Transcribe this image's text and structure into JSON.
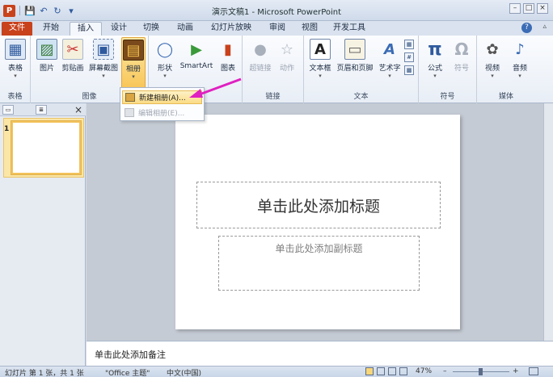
{
  "window": {
    "title": "演示文稿1 - Microsoft PowerPoint"
  },
  "qat": {
    "logo": "P",
    "save": "💾",
    "undo": "↶",
    "redo": "↻",
    "custom": "▾"
  },
  "controls": {
    "minimize": "–",
    "maximize": "□",
    "close": "×",
    "help": "?",
    "min_ribbon": "▵"
  },
  "tabs": [
    {
      "label": "文件"
    },
    {
      "label": "开始"
    },
    {
      "label": "插入"
    },
    {
      "label": "设计"
    },
    {
      "label": "切换"
    },
    {
      "label": "动画"
    },
    {
      "label": "幻灯片放映"
    },
    {
      "label": "审阅"
    },
    {
      "label": "视图"
    },
    {
      "label": "开发工具"
    }
  ],
  "ribbon": {
    "groups": {
      "tables": "表格",
      "images": "图像",
      "links": "链接",
      "text": "文本",
      "symbols": "符号",
      "media": "媒体"
    },
    "buttons": {
      "table": "表格",
      "picture": "图片",
      "clipart": "剪贴画",
      "screenshot": "屏幕截图",
      "album": "相册",
      "shapes": "形状",
      "smartart": "SmartArt",
      "chart": "图表",
      "hyperlink": "超链接",
      "action": "动作",
      "textbox": "文本框",
      "header_footer": "页眉和页脚",
      "wordart": "艺术字",
      "equation": "公式",
      "symbol": "符号",
      "video": "视频",
      "audio": "音频"
    },
    "glyphs": {
      "table": "▦",
      "picture": "▨",
      "clipart": "✂",
      "screenshot": "▣",
      "album": "▤",
      "shapes": "◯",
      "smartart": "▶",
      "chart": "▮",
      "hyperlink": "●",
      "action": "☆",
      "textbox": "A",
      "header_footer": "▭",
      "wordart": "A",
      "equation": "π",
      "symbol": "Ω",
      "video": "✿",
      "audio": "♪",
      "caret": "▾",
      "datetime": "▦",
      "slide_number": "#",
      "object": "▩"
    }
  },
  "album_menu": {
    "new": "新建相册(A)...",
    "edit": "编辑相册(E)..."
  },
  "left_pane": {
    "tab_slides": "▭",
    "tab_outline": "≣",
    "close": "×",
    "slide_number": "1"
  },
  "slide": {
    "title_placeholder": "单击此处添加标题",
    "subtitle_placeholder": "单击此处添加副标题"
  },
  "notes": {
    "placeholder": "单击此处添加备注"
  },
  "status": {
    "slide_info": "幻灯片 第 1 张，共 1 张",
    "theme": "\"Office 主题\"",
    "language": "中文(中国)",
    "zoom": "47%",
    "zoom_out": "–",
    "zoom_in": "+"
  },
  "colors": {
    "file_tab": "#c8421c",
    "arrow": "#e020c0",
    "highlight": "#f8c658"
  }
}
